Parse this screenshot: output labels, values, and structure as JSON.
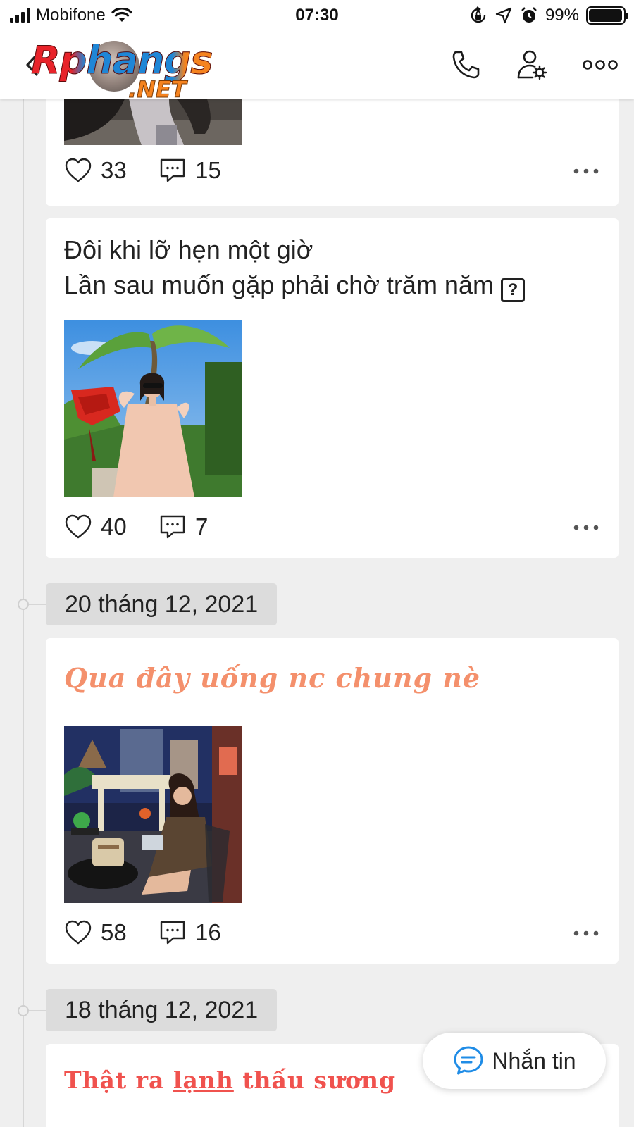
{
  "status_bar": {
    "carrier": "Mobifone",
    "time": "07:30",
    "battery": "99%",
    "battery_level": 0.99
  },
  "header": {
    "logo_text": "Rphangs",
    "logo_suffix": ".NET",
    "icons": [
      "back-chevron-icon",
      "phone-icon",
      "user-settings-icon",
      "more-icon"
    ]
  },
  "posts": [
    {
      "likes": "33",
      "comments": "15",
      "image": "dark-photo-partial"
    },
    {
      "text_line1": "Đôi khi lỡ hẹn một giờ",
      "text_line2": "Lần sau muốn gặp phải chờ trăm năm",
      "unknown_char": "?",
      "likes": "40",
      "comments": "7",
      "image": "woman-with-bouquet-photo"
    },
    {
      "date": "20 tháng 12, 2021",
      "text": "Qua đây uống nc chung nè",
      "likes": "58",
      "comments": "16",
      "image": "woman-at-street-cafe-photo"
    },
    {
      "date": "18 tháng 12, 2021",
      "text_a": "Thật ra ",
      "text_b": "lạnh",
      "text_c": " thấu sương"
    }
  ],
  "message_button": {
    "label": "Nhắn tin"
  },
  "colors": {
    "background": "#efefef",
    "card": "#ffffff",
    "date_chip": "#dcdcdc",
    "orange_text": "#f4906c",
    "red_text": "#f0524e",
    "message_icon": "#1f8ce6"
  }
}
